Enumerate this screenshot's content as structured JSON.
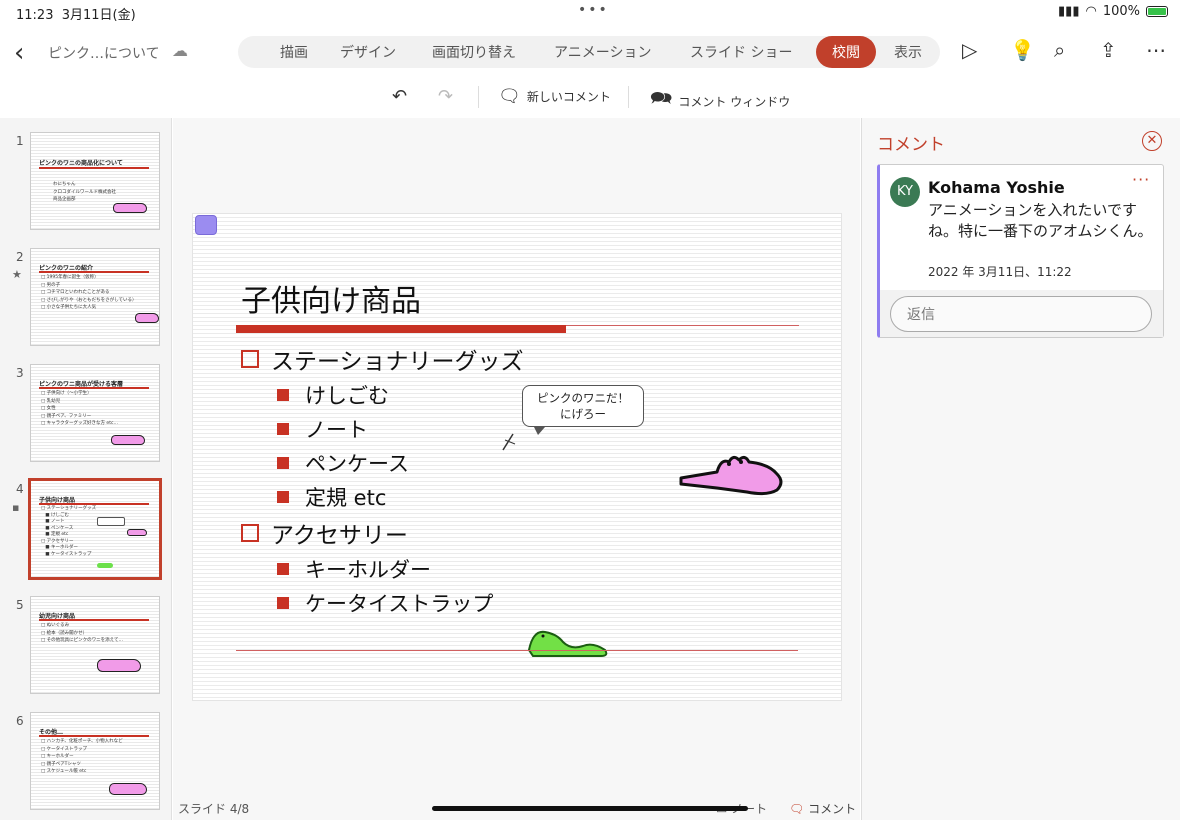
{
  "status": {
    "time": "11:23",
    "date": "3月11日(金)",
    "battery": "100%"
  },
  "ribbon": {
    "title": "ピンク…について",
    "tabs": [
      "描画",
      "デザイン",
      "画面切り替え",
      "アニメーション",
      "スライド ショー",
      "校閲",
      "表示"
    ],
    "active_tab": "校閲"
  },
  "subbar": {
    "new_comment": "新しいコメント",
    "comment_window": "コメント ウィンドウ"
  },
  "thumbnails": [
    {
      "num": "1",
      "title": "ピンクのワニの商品化について",
      "body": "わにちゃん\nクロコダイルワールド株式会社\n商品企画部"
    },
    {
      "num": "2",
      "title": "ピンクのワニの紹介",
      "body": "□ 1995年春に誕生（仮称）\n□ 男の子\n□ コチマロといわれたことがある\n□ さびしがりや（おともだちをさがしている）\n□ 小さな子供たちに大人気"
    },
    {
      "num": "3",
      "title": "ピンクのワニ商品が受ける客層",
      "body": "□ 子供向け（〜小学生）\n□ 乳幼児\n□ 女性\n□ 親子ペア、ファミリー\n□ キャラクターグッズ好きな方 etc…"
    },
    {
      "num": "4",
      "title": "子供向け商品",
      "body": "□ ステーショナリーグッズ\n   ■ けしごむ\n   ■ ノート\n   ■ ペンケース\n   ■ 定規 etc\n□ アクセサリー\n   ■ キーホルダー\n   ■ ケータイストラップ"
    },
    {
      "num": "5",
      "title": "幼児向け商品",
      "body": "□ ぬいぐるみ\n□ 絵本（読み聞かせ）\n□ その他玩具にピンクのワニを添えて…"
    },
    {
      "num": "6",
      "title": "その他…",
      "body": "□ ハンカチ、化粧ポーチ、小物入れなど\n□ ケータイストラップ\n□ キーホルダー\n□ 親子ペアTシャツ\n□ スケジュール帳 etc"
    }
  ],
  "slide": {
    "title": "子供向け商品",
    "level1": [
      "ステーショナリーグッズ",
      "アクセサリー"
    ],
    "stationery": [
      "けしごむ",
      "ノート",
      "ペンケース",
      "定規 etc"
    ],
    "accessories": [
      "キーホルダー",
      "ケータイストラップ"
    ],
    "bubble_line1": "ピンクのワニだ！",
    "bubble_line2": "にげろー"
  },
  "footer": {
    "counter": "スライド 4/8",
    "notes": "ノート",
    "comments": "コメント"
  },
  "pane": {
    "title": "コメント",
    "initials": "KY",
    "author": "Kohama Yoshie",
    "text": "アニメーションを入れたいですね。特に一番下のアオムシくん。",
    "time": "2022 年 3月11日、11:22",
    "reply_placeholder": "返信"
  },
  "colors": {
    "accent": "#c1402b",
    "slide_red": "#c83224",
    "comment_border": "#8f7df0",
    "avatar": "#3b7a54"
  }
}
